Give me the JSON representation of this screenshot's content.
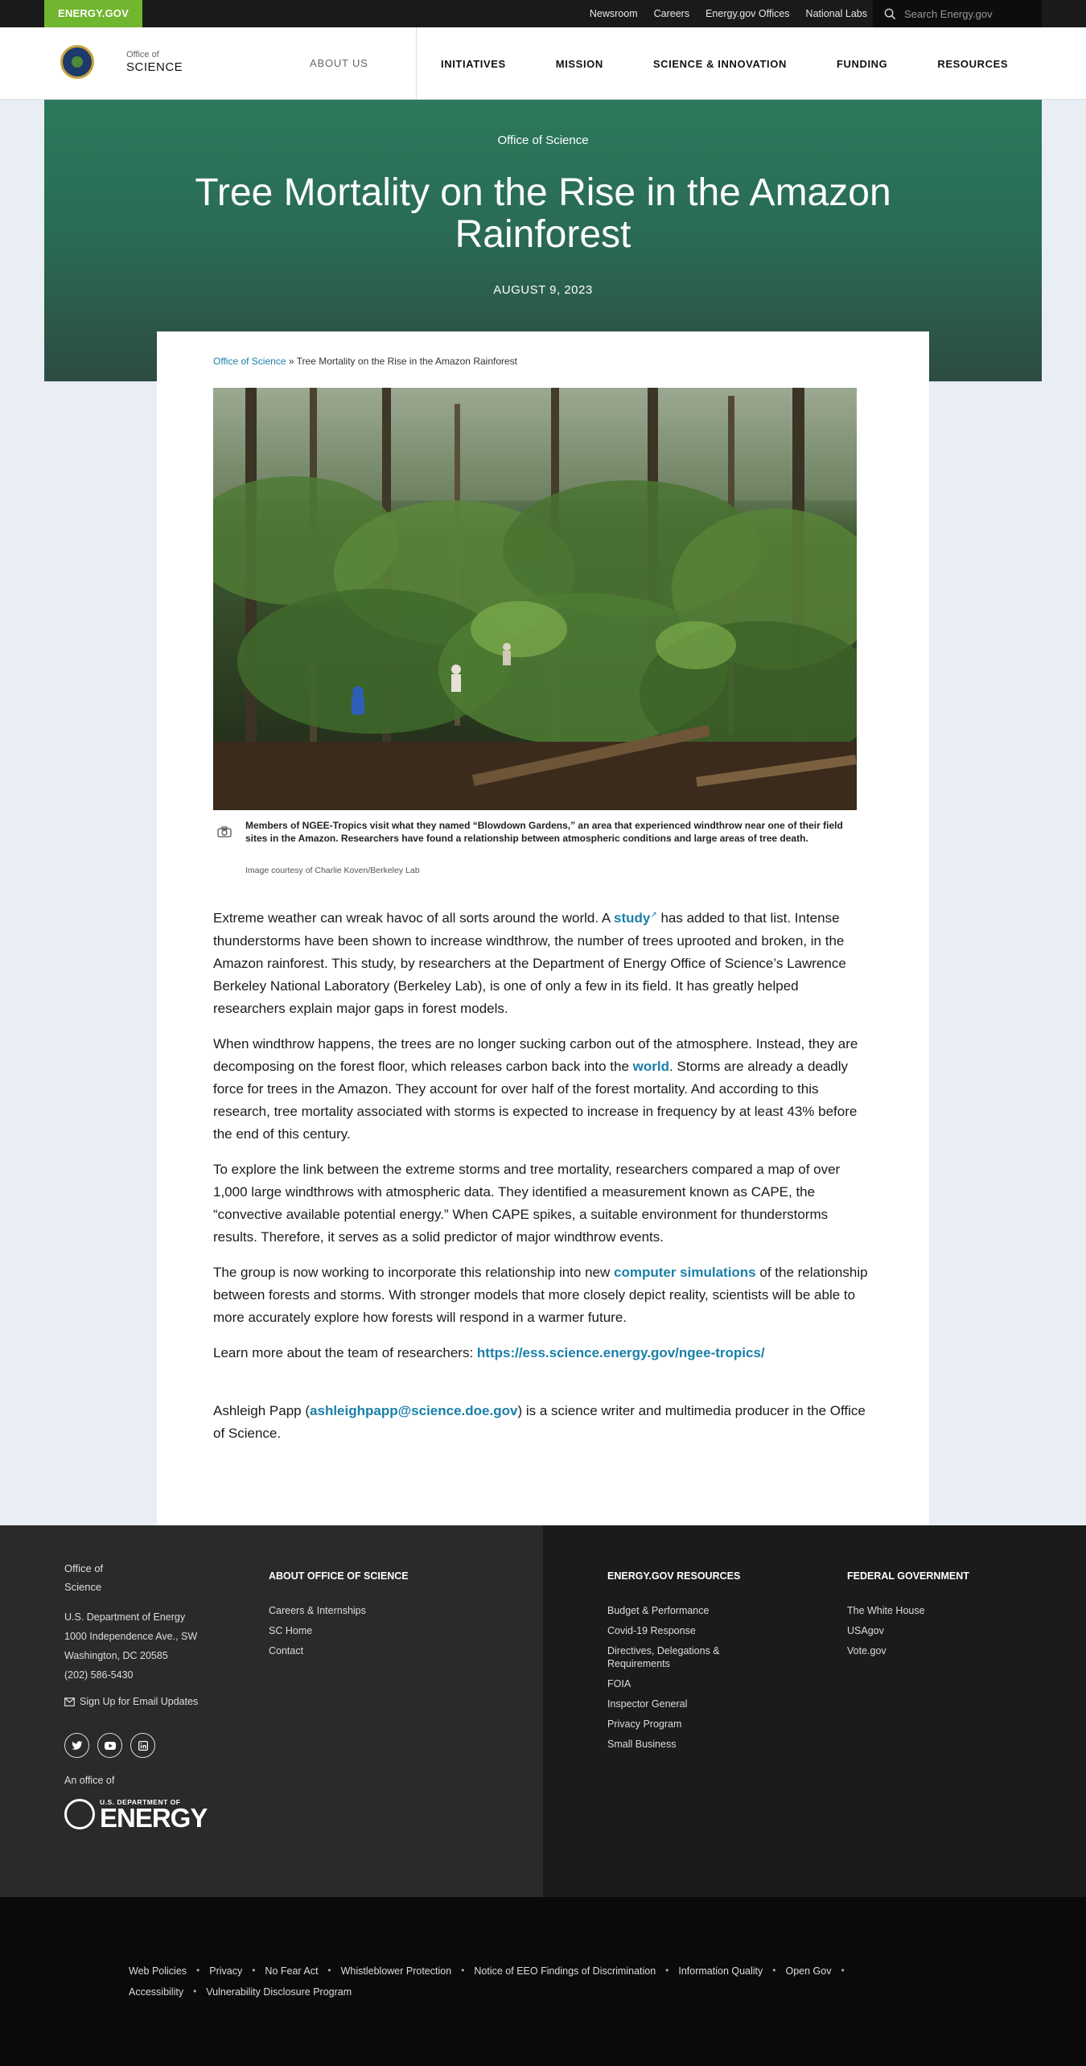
{
  "util_bar": {
    "brand": "ENERGY.GOV",
    "links": [
      "Newsroom",
      "Careers",
      "Energy.gov Offices",
      "National Labs"
    ],
    "search_placeholder": "Search Energy.gov"
  },
  "header": {
    "brand_small": "Office of",
    "brand_large": "SCIENCE",
    "about": "ABOUT US",
    "nav": [
      "INITIATIVES",
      "MISSION",
      "SCIENCE & INNOVATION",
      "FUNDING",
      "RESOURCES"
    ]
  },
  "hero": {
    "eyebrow": "Office of Science",
    "title": "Tree Mortality on the Rise in the Amazon Rainforest",
    "date": "AUGUST 9, 2023"
  },
  "breadcrumb": {
    "home": "Office of Science",
    "separator": "»",
    "current": "Tree Mortality on the Rise in the Amazon Rainforest"
  },
  "image": {
    "caption": "Members of NGEE-Tropics visit what they named “Blowdown Gardens,” an area that experienced windthrow near one of their field sites in the Amazon. Researchers have found a relationship between atmospheric conditions and large areas of tree death.",
    "credit": "Image courtesy of Charlie Koven/Berkeley Lab"
  },
  "article": {
    "p1_a": "Extreme weather can wreak havoc of all sorts around the world. A ",
    "p1_link": "study",
    "p1_b": " has added to that list. Intense thunderstorms have been shown to increase windthrow, the number of trees uprooted and broken, in the Amazon rainforest. This study, by researchers at the Department of Energy Office of Science’s Lawrence Berkeley National Laboratory (Berkeley Lab), is one of only a few in its field. It has greatly helped researchers explain major gaps in forest models.",
    "p2_a": "When windthrow happens, the trees are no longer sucking carbon out of the atmosphere. Instead, they are decomposing on the forest floor, which releases carbon back into the ",
    "p2_link": "world",
    "p2_b": ". Storms are already a deadly force for trees in the Amazon. They account for over half of the forest mortality. And according to this research, tree mortality associated with storms is expected to increase in frequency by at least 43% before the end of this century.",
    "p3": "To explore the link between the extreme storms and tree mortality, researchers compared a map of over 1,000 large windthrows with atmospheric data. They identified a measurement known as CAPE, the “convective available potential energy.” When CAPE spikes, a suitable environment for thunderstorms results. Therefore, it serves as a solid predictor of major windthrow events.",
    "p4_a": "The group is now working to incorporate this relationship into new ",
    "p4_link": "computer simulations",
    "p4_b": " of the relationship between forests and storms. With stronger models that more closely depict reality, scientists will be able to more accurately explore how forests will respond in a warmer future.",
    "p5_a": "Learn more about the team of researchers: ",
    "p5_link": "https://ess.science.energy.gov/ngee-tropics/",
    "p6_a": "Ashleigh Papp (",
    "p6_link": "ashleighpapp@science.doe.gov",
    "p6_b": ") is a science writer and multimedia producer in the Office of Science."
  },
  "footer": {
    "office_line1": "Office of",
    "office_line2": "Science",
    "address": [
      "U.S. Department of Energy",
      "1000 Independence Ave., SW",
      "Washington, DC 20585",
      "(202) 586-5430"
    ],
    "signup": "Sign Up for Email Updates",
    "an_office": "An office of",
    "doe_small": "U.S. DEPARTMENT OF",
    "doe_large": "ENERGY",
    "col_about": {
      "title": "ABOUT OFFICE OF SCIENCE",
      "links": [
        "Careers & Internships",
        "SC Home",
        "Contact"
      ]
    },
    "col_resources": {
      "title": "ENERGY.GOV RESOURCES",
      "links": [
        "Budget & Performance",
        "Covid-19 Response",
        "Directives, Delegations & Requirements",
        "FOIA",
        "Inspector General",
        "Privacy Program",
        "Small Business"
      ]
    },
    "col_federal": {
      "title": "FEDERAL GOVERNMENT",
      "links": [
        "The White House",
        "USAgov",
        "Vote.gov"
      ]
    }
  },
  "subfooter": {
    "links": [
      "Web Policies",
      "Privacy",
      "No Fear Act",
      "Whistleblower Protection",
      "Notice of EEO Findings of Discrimination",
      "Information Quality",
      "Open Gov",
      "Accessibility",
      "Vulnerability Disclosure Program"
    ]
  }
}
